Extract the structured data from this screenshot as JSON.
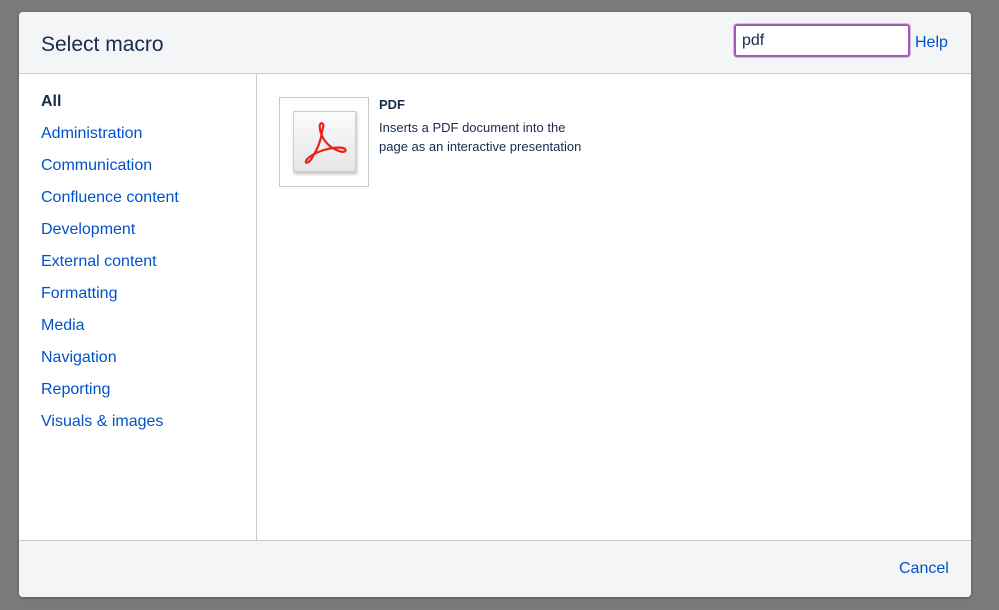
{
  "dialog": {
    "title": "Select macro",
    "search": {
      "value": "pdf",
      "placeholder": ""
    },
    "help_label": "Help",
    "cancel_label": "Cancel"
  },
  "sidebar": {
    "categories": [
      {
        "label": "All",
        "selected": true
      },
      {
        "label": "Administration",
        "selected": false
      },
      {
        "label": "Communication",
        "selected": false
      },
      {
        "label": "Confluence content",
        "selected": false
      },
      {
        "label": "Development",
        "selected": false
      },
      {
        "label": "External content",
        "selected": false
      },
      {
        "label": "Formatting",
        "selected": false
      },
      {
        "label": "Media",
        "selected": false
      },
      {
        "label": "Navigation",
        "selected": false
      },
      {
        "label": "Reporting",
        "selected": false
      },
      {
        "label": "Visuals & images",
        "selected": false
      }
    ]
  },
  "results": [
    {
      "name": "PDF",
      "description": "Inserts a PDF document into the page as an interactive presentation",
      "icon": "pdf-acrobat-icon"
    }
  ],
  "colors": {
    "link": "#0052cc",
    "text": "#172b4d",
    "search_focus": "#a05cb5",
    "pdf_red": "#e8221b"
  }
}
